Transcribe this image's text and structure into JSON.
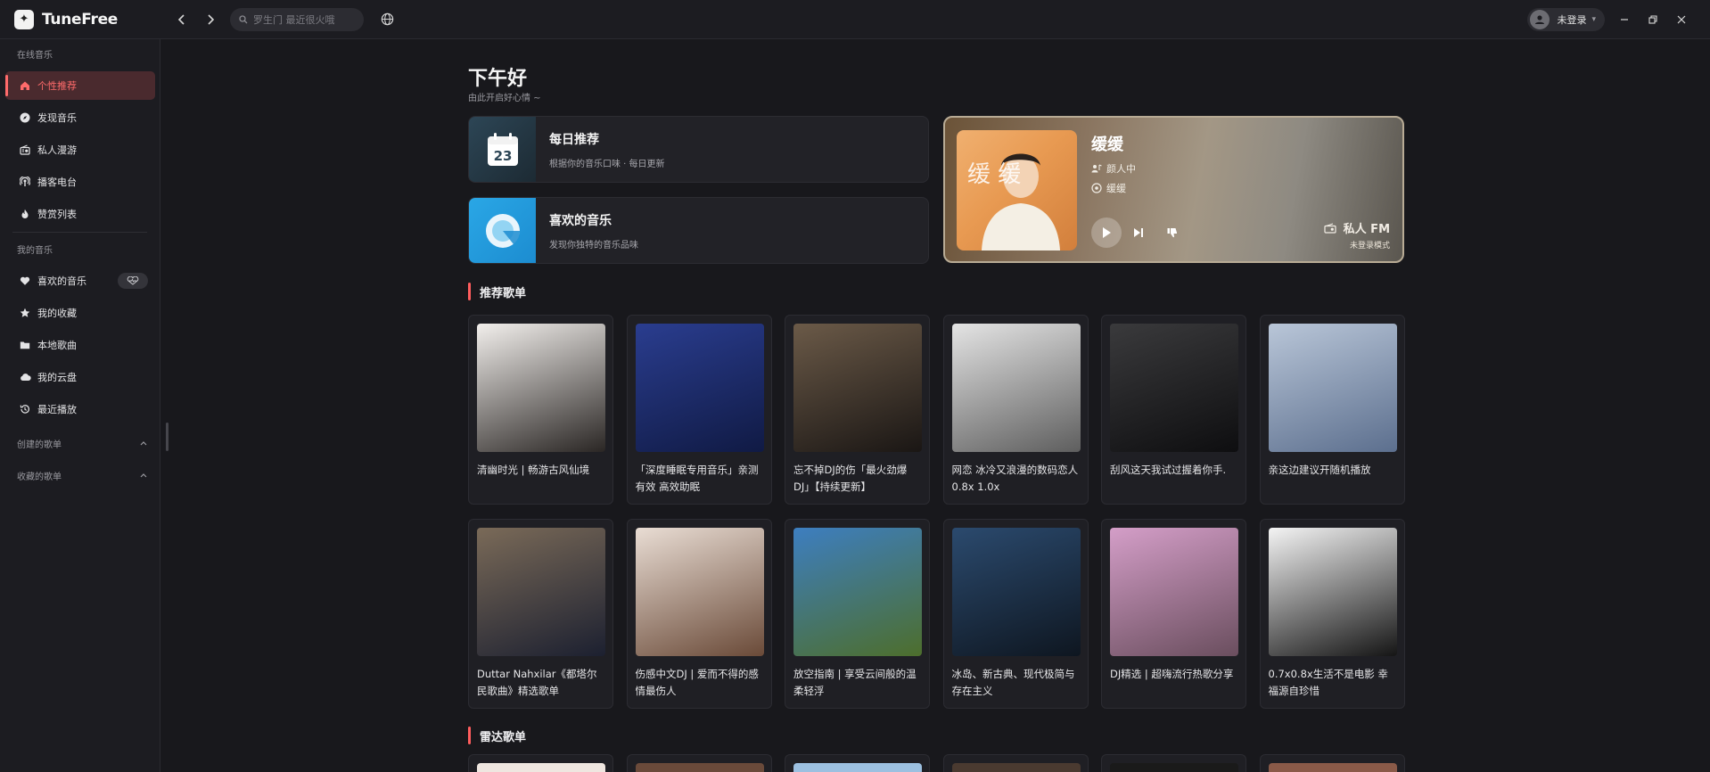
{
  "app": {
    "name": "TuneFree"
  },
  "titlebar": {
    "search_placeholder": "罗生门 最近很火哦",
    "user_label": "未登录"
  },
  "sidebar": {
    "online_section": "在线音乐",
    "online_items": [
      {
        "label": "个性推荐",
        "icon": "home-icon",
        "active": true
      },
      {
        "label": "发现音乐",
        "icon": "compass-icon",
        "active": false
      },
      {
        "label": "私人漫游",
        "icon": "radio-icon",
        "active": false
      },
      {
        "label": "播客电台",
        "icon": "podcast-icon",
        "active": false
      },
      {
        "label": "赞赏列表",
        "icon": "flame-icon",
        "active": false
      }
    ],
    "my_section": "我的音乐",
    "my_items": [
      {
        "label": "喜欢的音乐",
        "icon": "heart-icon"
      },
      {
        "label": "我的收藏",
        "icon": "star-icon"
      },
      {
        "label": "本地歌曲",
        "icon": "folder-icon"
      },
      {
        "label": "我的云盘",
        "icon": "cloud-icon"
      },
      {
        "label": "最近播放",
        "icon": "history-icon"
      }
    ],
    "created_playlists": "创建的歌单",
    "collected_playlists": "收藏的歌单"
  },
  "main": {
    "greeting": "下午好",
    "greeting_sub": "由此开启好心情 ~",
    "daily": {
      "title": "每日推荐",
      "subtitle": "根据你的音乐口味 · 每日更新",
      "date": "23"
    },
    "liked": {
      "title": "喜欢的音乐",
      "subtitle": "发现你独特的音乐品味"
    },
    "fm": {
      "song": "缓缓",
      "artist": "颜人中",
      "album": "缓缓",
      "brand": "私人 FM",
      "mode": "未登录模式",
      "cover_text": "缓 缓"
    },
    "recommend_title": "推荐歌单",
    "playlists": [
      {
        "name": "清幽时光 | 畅游古风仙境",
        "colors": [
          "#f2efec",
          "#2a2624"
        ]
      },
      {
        "name": "「深度睡眠专用音乐」亲测有效 高效助眠",
        "colors": [
          "#2a3d8f",
          "#101a44"
        ]
      },
      {
        "name": "忘不掉DJ的伤「最火劲爆DJ」【持续更新】",
        "colors": [
          "#6b5a48",
          "#1a1614"
        ]
      },
      {
        "name": "网恋 冰冷又浪漫的数码恋人 0.8x 1.0x",
        "colors": [
          "#e4e4e4",
          "#5e5e5e"
        ]
      },
      {
        "name": "刮风这天我试过握着你手.",
        "colors": [
          "#3a3a3c",
          "#0e0e10"
        ]
      },
      {
        "name": "亲这边建议开随机播放",
        "colors": [
          "#b9c6d8",
          "#5c6f8e"
        ]
      },
      {
        "name": "Duttar Nahxilar《都塔尔民歌曲》精选歌单",
        "colors": [
          "#7a6a58",
          "#1c2030"
        ]
      },
      {
        "name": "伤感中文DJ | 爱而不得的感情最伤人",
        "colors": [
          "#e9ddd4",
          "#6a4a38"
        ]
      },
      {
        "name": "放空指南 | 享受云间般的温柔轻浮",
        "colors": [
          "#3d7ec0",
          "#4d6e2c"
        ]
      },
      {
        "name": "冰岛、新古典、现代极简与存在主义",
        "colors": [
          "#2b4a6e",
          "#0e1620"
        ]
      },
      {
        "name": "DJ精选 | 超嗨流行热歌分享",
        "colors": [
          "#d49ec8",
          "#6a4e5e"
        ]
      },
      {
        "name": "0.7x0.8x生活不是电影 幸福源自珍惜",
        "colors": [
          "#f4f4f4",
          "#151515"
        ]
      }
    ],
    "radar_title": "雷达歌单",
    "radar_colors": [
      "#efe6e0",
      "#6a4a3a",
      "#9cc0e0",
      "#4a3a30",
      "#1a1a1a",
      "#8a5a48"
    ]
  },
  "colors": {
    "accent": "#ff6b6b",
    "bg": "#18181c",
    "sidebar_bg": "#1c1c21",
    "card_bg": "#1f1f24"
  }
}
